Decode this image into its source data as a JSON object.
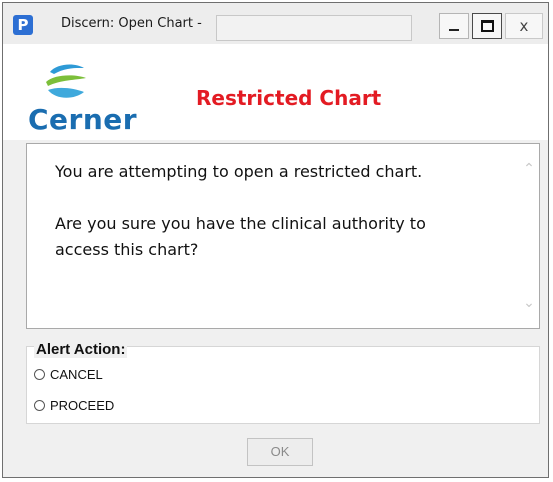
{
  "window": {
    "app_icon_letter": "P",
    "title": "Discern: Open Chart -",
    "close_glyph": "x"
  },
  "header": {
    "logo_text": "Cerner",
    "logo_trademark": ".",
    "title": "Restricted Chart",
    "title_color": "#e31b23",
    "logo_color": "#1a6db0"
  },
  "message": {
    "line1": "You are attempting to open a restricted chart.",
    "line2": "Are you sure you have the clinical authority to",
    "line3": "access this chart?"
  },
  "alert_action": {
    "label": "Alert Action:",
    "options": [
      {
        "label": "CANCEL",
        "selected": false
      },
      {
        "label": "PROCEED",
        "selected": false
      }
    ]
  },
  "buttons": {
    "ok_label": "OK",
    "ok_enabled": false
  },
  "icons": {
    "app": "app-p-icon",
    "minimize": "minimize-icon",
    "maximize": "maximize-icon",
    "close": "close-icon",
    "logo": "cerner-logo-icon",
    "scroll_up": "chevron-up-icon",
    "scroll_down": "chevron-down-icon"
  }
}
